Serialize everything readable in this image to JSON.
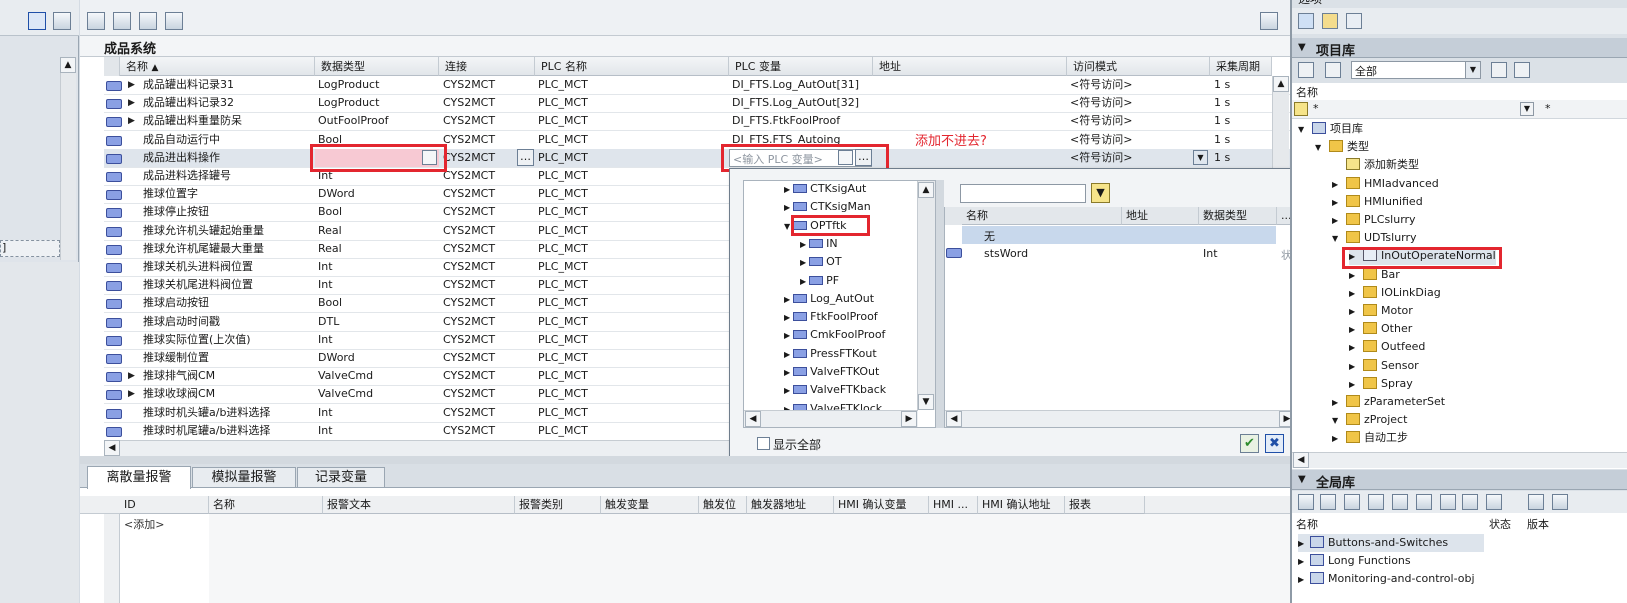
{
  "left_panel": {
    "marker": "]"
  },
  "section_title": "成品系统",
  "columns": [
    "名称",
    "数据类型",
    "连接",
    "PLC 名称",
    "PLC 变量",
    "地址",
    "访问模式",
    "采集周期"
  ],
  "sort_indicator": "▲",
  "rows": [
    {
      "name": "成品罐出料记录31",
      "type": "LogProduct",
      "conn": "CYS2MCT",
      "plc": "PLC_MCT",
      "var": "DI_FTS.Log_AutOut[31]",
      "access": "<符号访问>",
      "cycle": "1 s",
      "expandable": true
    },
    {
      "name": "成品罐出料记录32",
      "type": "LogProduct",
      "conn": "CYS2MCT",
      "plc": "PLC_MCT",
      "var": "DI_FTS.Log_AutOut[32]",
      "access": "<符号访问>",
      "cycle": "1 s",
      "expandable": true
    },
    {
      "name": "成品罐出料重量防呆",
      "type": "OutFoolProof",
      "conn": "CYS2MCT",
      "plc": "PLC_MCT",
      "var": "DI_FTS.FtkFoolProof",
      "access": "<符号访问>",
      "cycle": "1 s",
      "expandable": true
    },
    {
      "name": "成品自动运行中",
      "type": "Bool",
      "conn": "CYS2MCT",
      "plc": "PLC_MCT",
      "var": "DI_FTS.FTS_Autoing",
      "access": "<符号访问>",
      "cycle": "1 s",
      "expandable": false
    },
    {
      "name": "成品进出料操作",
      "type": "",
      "conn": "CYS2MCT",
      "plc": "PLC_MCT",
      "var": "",
      "access": "<符号访问>",
      "cycle": "1 s",
      "expandable": false
    },
    {
      "name": "成品进料选择罐号",
      "type": "Int",
      "conn": "CYS2MCT",
      "plc": "PLC_MCT",
      "var": "",
      "access": "",
      "cycle": "",
      "expandable": false
    },
    {
      "name": "推球位置字",
      "type": "DWord",
      "conn": "CYS2MCT",
      "plc": "PLC_MCT",
      "var": "",
      "access": "",
      "cycle": "",
      "expandable": false
    },
    {
      "name": "推球停止按钮",
      "type": "Bool",
      "conn": "CYS2MCT",
      "plc": "PLC_MCT",
      "var": "",
      "access": "",
      "cycle": "",
      "expandable": false
    },
    {
      "name": "推球允许机头罐起始重量",
      "type": "Real",
      "conn": "CYS2MCT",
      "plc": "PLC_MCT",
      "var": "",
      "access": "",
      "cycle": "",
      "expandable": false
    },
    {
      "name": "推球允许机尾罐最大重量",
      "type": "Real",
      "conn": "CYS2MCT",
      "plc": "PLC_MCT",
      "var": "",
      "access": "",
      "cycle": "",
      "expandable": false
    },
    {
      "name": "推球关机头进料阀位置",
      "type": "Int",
      "conn": "CYS2MCT",
      "plc": "PLC_MCT",
      "var": "",
      "access": "",
      "cycle": "",
      "expandable": false
    },
    {
      "name": "推球关机尾进料阀位置",
      "type": "Int",
      "conn": "CYS2MCT",
      "plc": "PLC_MCT",
      "var": "",
      "access": "",
      "cycle": "",
      "expandable": false
    },
    {
      "name": "推球启动按钮",
      "type": "Bool",
      "conn": "CYS2MCT",
      "plc": "PLC_MCT",
      "var": "",
      "access": "",
      "cycle": "",
      "expandable": false
    },
    {
      "name": "推球启动时间戳",
      "type": "DTL",
      "conn": "CYS2MCT",
      "plc": "PLC_MCT",
      "var": "",
      "access": "",
      "cycle": "",
      "expandable": false
    },
    {
      "name": "推球实际位置(上次值)",
      "type": "Int",
      "conn": "CYS2MCT",
      "plc": "PLC_MCT",
      "var": "",
      "access": "",
      "cycle": "",
      "expandable": false
    },
    {
      "name": "推球缓制位置",
      "type": "DWord",
      "conn": "CYS2MCT",
      "plc": "PLC_MCT",
      "var": "",
      "access": "",
      "cycle": "",
      "expandable": false
    },
    {
      "name": "推球排气阀CM",
      "type": "ValveCmd",
      "conn": "CYS2MCT",
      "plc": "PLC_MCT",
      "var": "",
      "access": "",
      "cycle": "",
      "expandable": true
    },
    {
      "name": "推球收球阀CM",
      "type": "ValveCmd",
      "conn": "CYS2MCT",
      "plc": "PLC_MCT",
      "var": "",
      "access": "",
      "cycle": "",
      "expandable": true
    },
    {
      "name": "推球时机头罐a/b进料选择",
      "type": "Int",
      "conn": "CYS2MCT",
      "plc": "PLC_MCT",
      "var": "",
      "access": "",
      "cycle": "",
      "expandable": false
    },
    {
      "name": "推球时机尾罐a/b进料选择",
      "type": "Int",
      "conn": "CYS2MCT",
      "plc": "PLC_MCT",
      "var": "",
      "access": "",
      "cycle": "",
      "expandable": false
    }
  ],
  "plc_var_placeholder": "<输入 PLC 变量>",
  "annotation": "添加不进去?",
  "popup": {
    "tree": [
      {
        "label": "CTKsigAut",
        "indent": 0,
        "expander": "▶"
      },
      {
        "label": "CTKsigMan",
        "indent": 0,
        "expander": "▶"
      },
      {
        "label": "OPTftk",
        "indent": 0,
        "expander": "▼"
      },
      {
        "label": "IN",
        "indent": 1,
        "expander": "▶"
      },
      {
        "label": "OT",
        "indent": 1,
        "expander": "▶"
      },
      {
        "label": "PF",
        "indent": 1,
        "expander": "▶"
      },
      {
        "label": "Log_AutOut",
        "indent": 0,
        "expander": "▶"
      },
      {
        "label": "FtkFoolProof",
        "indent": 0,
        "expander": "▶"
      },
      {
        "label": "CmkFoolProof",
        "indent": 0,
        "expander": "▶"
      },
      {
        "label": "PressFTKout",
        "indent": 0,
        "expander": "▶"
      },
      {
        "label": "ValveFTKOut",
        "indent": 0,
        "expander": "▶"
      },
      {
        "label": "ValveFTKback",
        "indent": 0,
        "expander": "▶"
      },
      {
        "label": "ValveFTKlock",
        "indent": 0,
        "expander": "▶"
      }
    ],
    "list_columns": [
      "名称",
      "地址",
      "数据类型",
      "..."
    ],
    "list_rows": [
      {
        "name": "无",
        "addr": "",
        "type": "",
        "extra": ""
      },
      {
        "name": "stsWord",
        "addr": "",
        "type": "Int",
        "extra": "状态"
      }
    ],
    "show_all_label": "显示全部",
    "ok_glyph": "✔",
    "cancel_glyph": "✖"
  },
  "bottom_tabs": [
    "离散量报警",
    "模拟量报警",
    "记录变量"
  ],
  "alarm_columns": [
    "ID",
    "名称",
    "报警文本",
    "报警类别",
    "触发变量",
    "触发位",
    "触发器地址",
    "HMI 确认变量",
    "HMI ...",
    "HMI 确认地址",
    "报表"
  ],
  "alarm_add": "<添加>",
  "right": {
    "top_title": "选项",
    "project_lib_title": "项目库",
    "filter_value": "全部",
    "name_header": "名称",
    "filter_text": "*",
    "tree": [
      {
        "label": "项目库",
        "indent": 0,
        "expander": "▼",
        "kind": "lib"
      },
      {
        "label": "类型",
        "indent": 1,
        "expander": "▼",
        "kind": "folder"
      },
      {
        "label": "添加新类型",
        "indent": 2,
        "expander": "",
        "kind": "add"
      },
      {
        "label": "HMIadvanced",
        "indent": 2,
        "expander": "▶",
        "kind": "folder"
      },
      {
        "label": "HMIunified",
        "indent": 2,
        "expander": "▶",
        "kind": "folder"
      },
      {
        "label": "PLCslurry",
        "indent": 2,
        "expander": "▶",
        "kind": "folder"
      },
      {
        "label": "UDTslurry",
        "indent": 2,
        "expander": "▼",
        "kind": "folder"
      },
      {
        "label": "InOutOperateNormal",
        "indent": 3,
        "expander": "▶",
        "kind": "type"
      },
      {
        "label": "Bar",
        "indent": 3,
        "expander": "▶",
        "kind": "folder"
      },
      {
        "label": "IOLinkDiag",
        "indent": 3,
        "expander": "▶",
        "kind": "folder"
      },
      {
        "label": "Motor",
        "indent": 3,
        "expander": "▶",
        "kind": "folder"
      },
      {
        "label": "Other",
        "indent": 3,
        "expander": "▶",
        "kind": "folder"
      },
      {
        "label": "Outfeed",
        "indent": 3,
        "expander": "▶",
        "kind": "folder"
      },
      {
        "label": "Sensor",
        "indent": 3,
        "expander": "▶",
        "kind": "folder"
      },
      {
        "label": "Spray",
        "indent": 3,
        "expander": "▶",
        "kind": "folder"
      },
      {
        "label": "zParameterSet",
        "indent": 2,
        "expander": "▶",
        "kind": "folder"
      },
      {
        "label": "zProject",
        "indent": 2,
        "expander": "▼",
        "kind": "folder"
      },
      {
        "label": "自动工步",
        "indent": 2,
        "expander": "▶",
        "kind": "folder"
      }
    ],
    "global_lib_title": "全局库",
    "global_cols": [
      "名称",
      "状态",
      "版本"
    ],
    "global_items": [
      "Buttons-and-Switches",
      "Long Functions",
      "Monitoring-and-control-obj"
    ]
  },
  "colors": {
    "highlight_red": "#e3262f",
    "selected_row": "#c8d8ec",
    "invalid_cell": "#f7c9d3",
    "accent_blue": "#1f4fa8"
  }
}
